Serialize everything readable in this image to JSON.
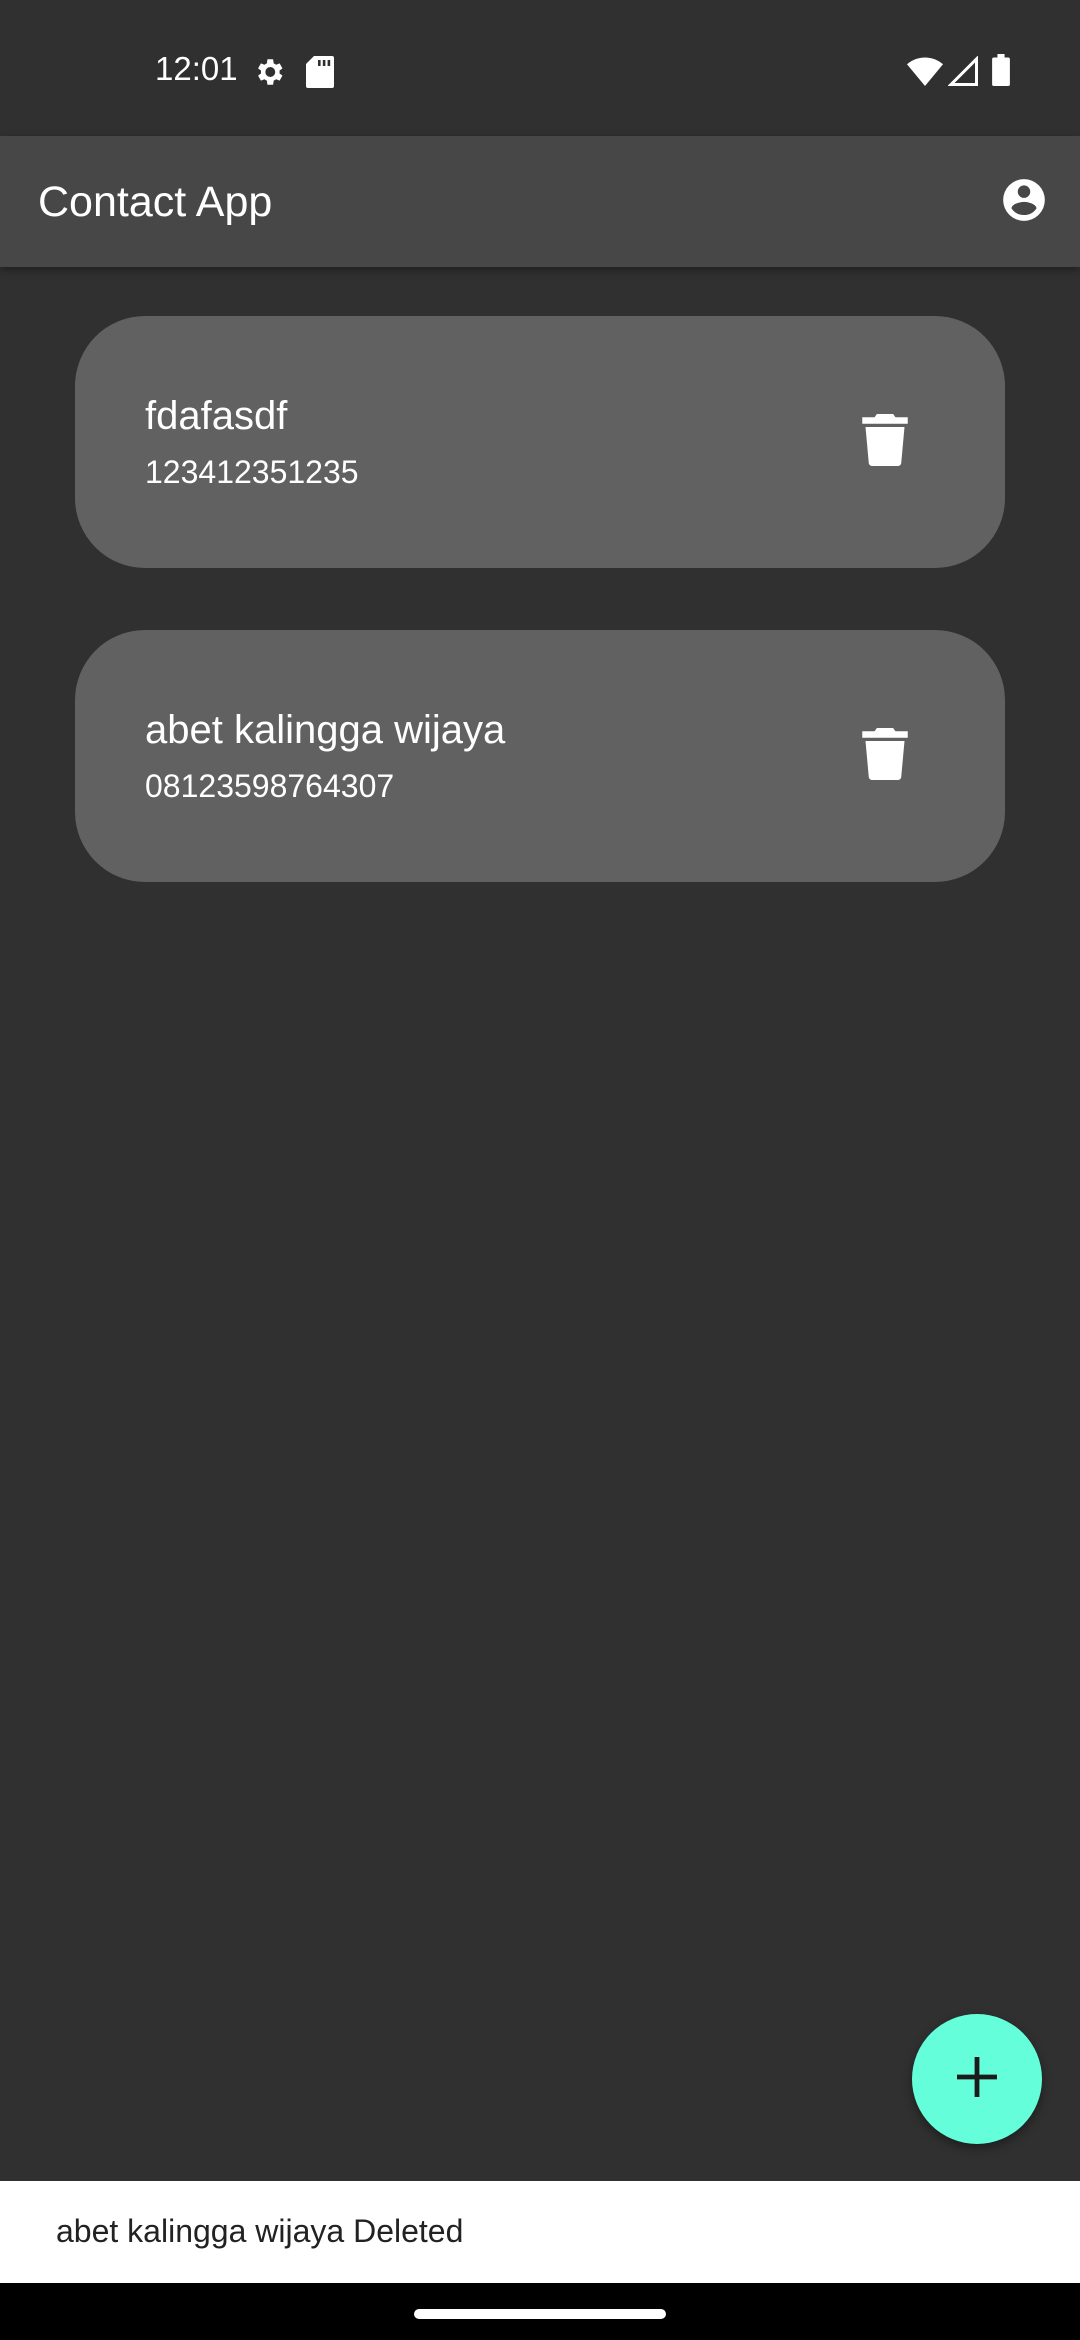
{
  "status_bar": {
    "time": "12:01",
    "icons_left": [
      "settings-gear-icon",
      "sd-card-icon"
    ],
    "icons_right": [
      "wifi-icon",
      "cellular-signal-icon",
      "battery-icon"
    ]
  },
  "app_bar": {
    "title": "Contact App",
    "action_icon": "account-circle-icon"
  },
  "contacts": [
    {
      "name": "fdafasdf",
      "phone": "123412351235",
      "action_icon": "delete-icon"
    },
    {
      "name": "abet kalingga wijaya",
      "phone": "08123598764307",
      "action_icon": "delete-icon"
    }
  ],
  "fab": {
    "icon": "add-icon"
  },
  "snackbar": {
    "message": "abet kalingga wijaya Deleted"
  },
  "colors": {
    "background": "#303030",
    "app_bar": "#474747",
    "card": "#616161",
    "fab": "#64ffda",
    "snackbar": "#ffffff"
  }
}
